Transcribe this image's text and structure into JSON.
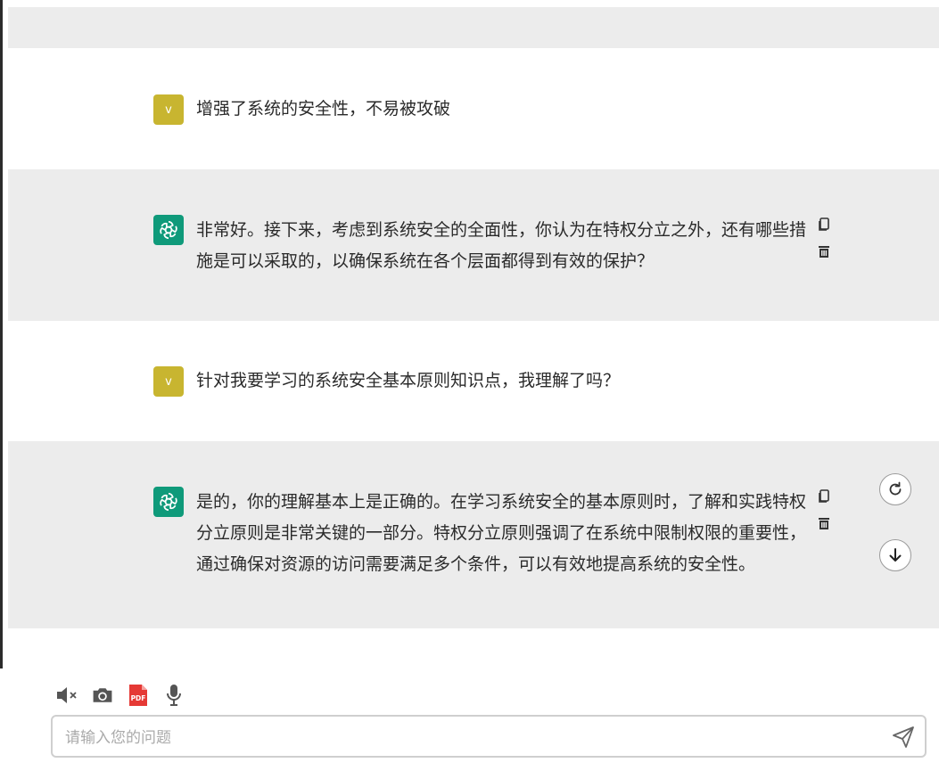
{
  "messages": [
    {
      "role": "user",
      "avatar": "v",
      "text": "增强了系统的安全性，不易被攻破"
    },
    {
      "role": "assistant",
      "icon": "openai-logo-icon",
      "text": "非常好。接下来，考虑到系统安全的全面性，你认为在特权分立之外，还有哪些措施是可以采取的，以确保系统在各个层面都得到有效的保护？"
    },
    {
      "role": "user",
      "avatar": "v",
      "text": "针对我要学习的系统安全基本原则知识点，我理解了吗？"
    },
    {
      "role": "assistant",
      "icon": "openai-logo-icon",
      "text": "是的，你的理解基本上是正确的。在学习系统安全的基本原则时，了解和实践特权分立原则是非常关键的一部分。特权分立原则强调了在系统中限制权限的重要性，通过确保对资源的访问需要满足多个条件，可以有效地提高系统的安全性。"
    }
  ],
  "message_actions": [
    "copy-icon",
    "trash-icon"
  ],
  "floating_buttons": [
    "regenerate-icon",
    "scroll-down-icon"
  ],
  "toolbar": [
    "mute-icon",
    "camera-icon",
    "pdf-icon",
    "microphone-icon"
  ],
  "toolbar_pdf_label": "PDF",
  "input": {
    "placeholder": "请输入您的问题",
    "value": ""
  },
  "colors": {
    "band_bg": "#ececec",
    "user_avatar": "#c8b530",
    "bot_avatar": "#0f9a7a",
    "pdf_red": "#e53935"
  }
}
